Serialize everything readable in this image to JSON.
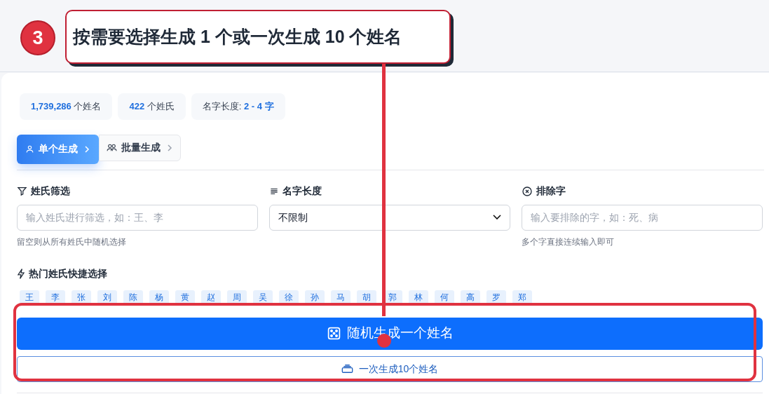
{
  "callout": {
    "step": "3",
    "text": "按需要选择生成 1 个或一次生成 10 个姓名"
  },
  "stats": [
    {
      "text": "**1,739,286** 个姓名"
    },
    {
      "text": "**422** 个姓氏"
    },
    {
      "text": "名字长度: **2 - 4 字**"
    }
  ],
  "tabs": [
    {
      "label": "单个生成",
      "kind": "single",
      "selected": true
    },
    {
      "label": "批量生成",
      "kind": "batch",
      "selected": false
    }
  ],
  "filters": [
    {
      "label": "姓氏筛选",
      "kind": "filter",
      "placeholder": "输入姓氏进行筛选，如：王、李",
      "hint": "留空则从所有姓氏中随机选择"
    },
    {
      "label": "名字长度",
      "kind": "select",
      "value": "不限制"
    },
    {
      "label": "排除字",
      "kind": "exclude",
      "placeholder": "输入要排除的字，如：死、病",
      "hint": "多个字直接连续输入即可"
    }
  ],
  "hot_surnames": {
    "label": "热门姓氏快捷选择",
    "items": [
      "王",
      "李",
      "张",
      "刘",
      "陈",
      "杨",
      "黄",
      "赵",
      "周",
      "吴",
      "徐",
      "孙",
      "马",
      "胡",
      "郭",
      "林",
      "何",
      "高",
      "罗",
      "郑"
    ]
  },
  "buttons": [
    {
      "label": "随机生成一个姓名",
      "kind": "primary"
    },
    {
      "label": "一次生成10个姓名",
      "kind": "outline"
    }
  ]
}
